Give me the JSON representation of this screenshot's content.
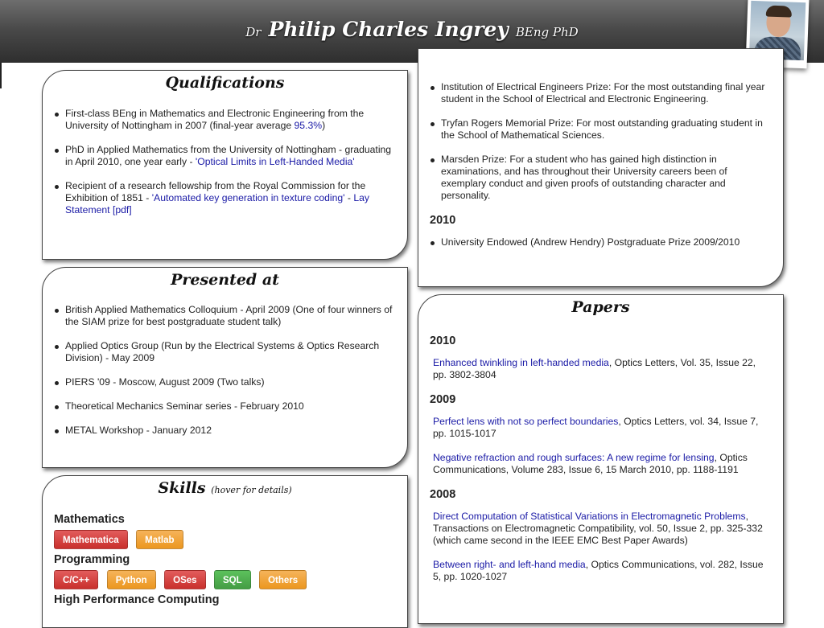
{
  "header": {
    "prefix": "Dr",
    "name": "Philip Charles Ingrey",
    "suffix": "BEng PhD"
  },
  "qualifications": {
    "title": "Qualifications",
    "items": [
      {
        "text": "First-class BEng in Mathematics and Electronic Engineering from the University of Nottingham in 2007 (final-year average ",
        "link": "95.3%",
        "tail": ")"
      },
      {
        "text": "PhD in Applied Mathematics from the University of Nottingham - graduating in April 2010, one year early - ",
        "link": "'Optical Limits in Left-Handed Media'",
        "tail": ""
      },
      {
        "text": "Recipient of a research fellowship from the Royal Commission for the Exhibition of 1851 - ",
        "link": "'Automated key generation in texture coding'",
        "mid": " - ",
        "link2": "Lay Statement [pdf]"
      }
    ]
  },
  "presented": {
    "title": "Presented at",
    "items": [
      "British Applied Mathematics Colloquium - April 2009 (One of four winners of the SIAM prize for best postgraduate student talk)",
      "Applied Optics Group (Run by the Electrical Systems & Optics Research Division) - May 2009",
      "PIERS '09 - Moscow, August 2009 (Two talks)",
      "Theoretical Mechanics Seminar series - February 2010",
      "METAL Workshop - January 2012"
    ]
  },
  "skills": {
    "title": "Skills",
    "subtitle": "(hover for details)",
    "categories": [
      {
        "name": "Mathematics",
        "badges": [
          {
            "label": "Mathematica",
            "color": "red"
          },
          {
            "label": "Matlab",
            "color": "orange"
          }
        ]
      },
      {
        "name": "Programming",
        "badges": [
          {
            "label": "C/C++",
            "color": "red"
          },
          {
            "label": "Python",
            "color": "orange"
          },
          {
            "label": "OSes",
            "color": "red"
          },
          {
            "label": "SQL",
            "color": "green"
          },
          {
            "label": "Others",
            "color": "orange"
          }
        ]
      },
      {
        "name": "High Performance Computing",
        "badges": []
      }
    ]
  },
  "prizes": {
    "items": [
      "Institution of Electrical Engineers Prize: For the most outstanding final year student in the School of Electrical and Electronic Engineering.",
      "Tryfan Rogers Memorial Prize: For most outstanding graduating student in the School of Mathematical Sciences.",
      "Marsden Prize: For a student who has gained high distinction in examinations, and has throughout their University careers been of exemplary conduct and given proofs of outstanding character and personality."
    ],
    "year2": "2010",
    "items2": [
      "University Endowed (Andrew Hendry) Postgraduate Prize 2009/2010"
    ]
  },
  "papers": {
    "title": "Papers",
    "groups": [
      {
        "year": "2010",
        "papers": [
          {
            "link": "Enhanced twinkling in left-handed media",
            "rest": ", Optics Letters, Vol. 35, Issue 22, pp. 3802-3804"
          }
        ]
      },
      {
        "year": "2009",
        "papers": [
          {
            "link": "Perfect lens with not so perfect boundaries",
            "rest": ", Optics Letters, vol. 34, Issue 7, pp. 1015-1017"
          },
          {
            "link": "Negative refraction and rough surfaces: A new regime for lensing",
            "rest": ", Optics Communications, Volume 283, Issue 6, 15 March 2010, pp. 1188-1191"
          }
        ]
      },
      {
        "year": "2008",
        "papers": [
          {
            "link": "Direct Computation of Statistical Variations in Electromagnetic Problems",
            "rest": ", Transactions on Electromagnetic Compatibility, vol. 50, Issue 2, pp. 325-332 (which came second in the IEEE EMC Best Paper Awards)"
          },
          {
            "link": "Between right- and left-hand media",
            "rest": ", Optics Communications, vol. 282, Issue 5, pp. 1020-1027"
          }
        ]
      }
    ]
  },
  "colors": {
    "link": "#1a1aa6",
    "badge_red": "#c9302c",
    "badge_orange": "#ec971f",
    "badge_green": "#449d44"
  }
}
